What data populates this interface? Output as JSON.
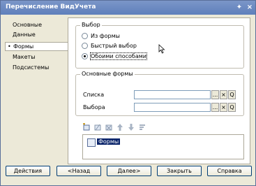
{
  "window": {
    "title": "Перечисление ВидУчета",
    "pin_glyph": "✦",
    "close_glyph": "×"
  },
  "sidebar": {
    "selected_marker": "•",
    "items": [
      {
        "label": "Основные"
      },
      {
        "label": "Данные"
      },
      {
        "label": "Формы"
      },
      {
        "label": "Макеты"
      },
      {
        "label": "Подсистемы"
      }
    ]
  },
  "choice": {
    "title": "Выбор",
    "options": [
      {
        "label": "Из формы",
        "selected": false
      },
      {
        "label": "Быстрый выбор",
        "selected": false
      },
      {
        "label": "Обоими способами",
        "selected": true
      }
    ]
  },
  "main_forms": {
    "title": "Основные формы",
    "list_label": "Списка",
    "choose_label": "Выбора",
    "list_value": "",
    "choose_value": "",
    "dots": "...",
    "clear": "×",
    "search": "Q"
  },
  "tree": {
    "node_label": "Формы"
  },
  "buttons": {
    "actions": "Действия",
    "back": "<Назад",
    "next": "Далее>",
    "close": "Закрыть",
    "help": "Справка"
  }
}
